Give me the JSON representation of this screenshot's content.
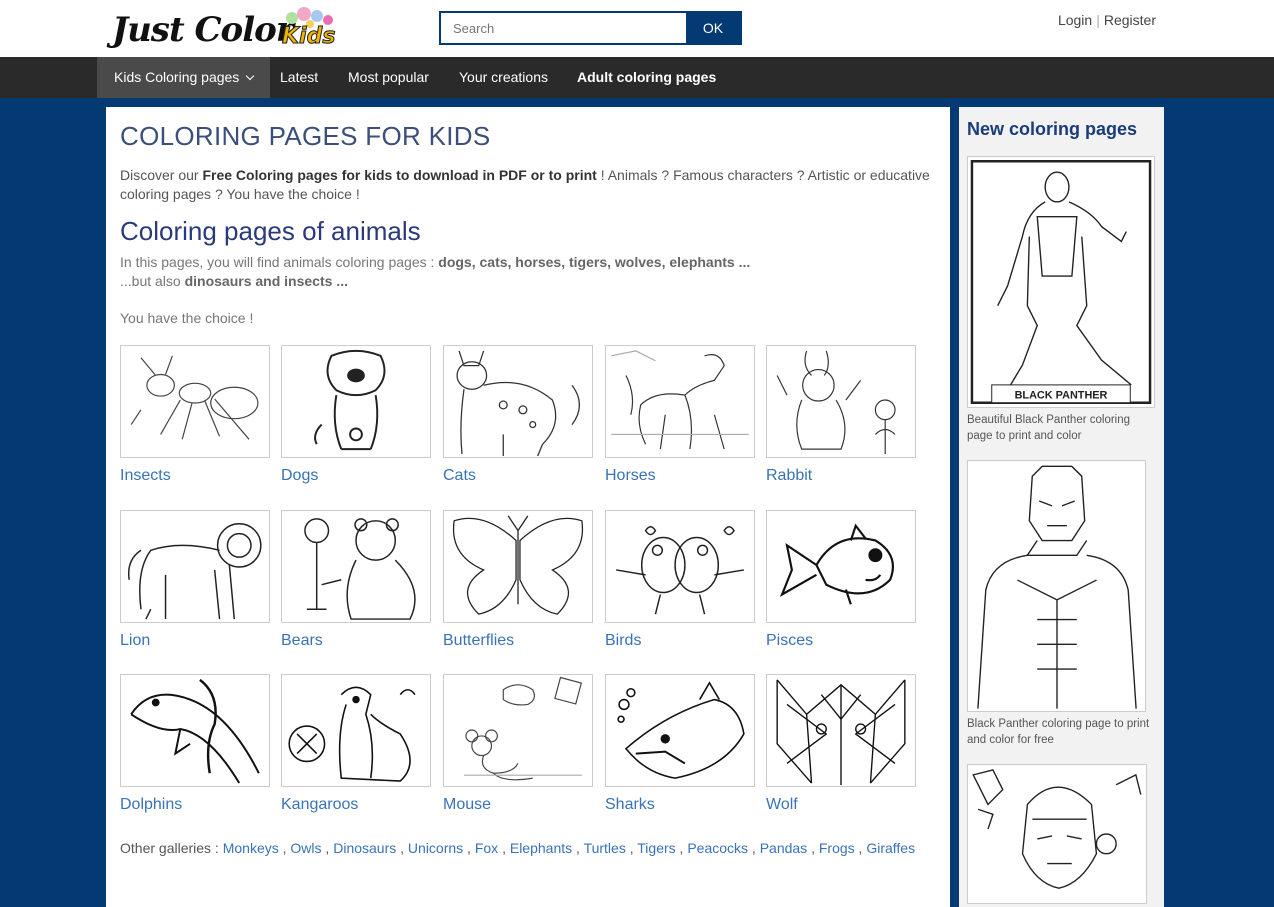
{
  "header": {
    "logo_text": "Just Color",
    "logo_kids": "Kids",
    "search_placeholder": "Search",
    "search_button": "OK",
    "login": "Login",
    "register": "Register"
  },
  "nav": {
    "items": [
      {
        "label": "Kids Coloring pages"
      },
      {
        "label": "Latest"
      },
      {
        "label": "Most popular"
      },
      {
        "label": "Your creations"
      },
      {
        "label": "Adult coloring pages"
      }
    ]
  },
  "main": {
    "title": "COLORING PAGES FOR KIDS",
    "intro_pre": "Discover our ",
    "intro_bold": "Free Coloring pages for kids to download in PDF or to print",
    "intro_post": " ! Animals ? Famous characters ? Artistic or educative coloring pages ? You have the choice !",
    "section_title": "Coloring pages of animals",
    "section_line1_pre": "In this pages, you will find animals coloring pages : ",
    "section_line1_bold": "dogs, cats, horses, tigers, wolves, elephants ...",
    "section_line2_pre": "...but also ",
    "section_line2_bold": "dinosaurs and insects ...",
    "choice": "You have the choice !",
    "categories": [
      {
        "label": "Insects"
      },
      {
        "label": "Dogs"
      },
      {
        "label": "Cats"
      },
      {
        "label": "Horses"
      },
      {
        "label": "Rabbit"
      },
      {
        "label": "Lion"
      },
      {
        "label": "Bears"
      },
      {
        "label": "Butterflies"
      },
      {
        "label": "Birds"
      },
      {
        "label": "Pisces"
      },
      {
        "label": "Dolphins"
      },
      {
        "label": "Kangaroos"
      },
      {
        "label": "Mouse"
      },
      {
        "label": "Sharks"
      },
      {
        "label": "Wolf"
      }
    ],
    "other_label": "Other galleries :",
    "other_galleries": [
      "Monkeys",
      "Owls",
      "Dinosaurs",
      "Unicorns",
      "Fox",
      "Elephants",
      "Turtles",
      "Tigers",
      "Peacocks",
      "Pandas",
      "Frogs",
      "Giraffes"
    ]
  },
  "sidebar": {
    "title": "New coloring pages",
    "items": [
      {
        "caption": "Beautiful Black Panther coloring page to print and color",
        "image_text": "BLACK PANTHER"
      },
      {
        "caption": "Black Panther coloring page to print and color for free"
      },
      {
        "caption": ""
      }
    ]
  },
  "colors": {
    "background": "#043a73",
    "nav": "#2a2a2a",
    "link": "#3a72b8",
    "title": "#3a4f7a"
  }
}
